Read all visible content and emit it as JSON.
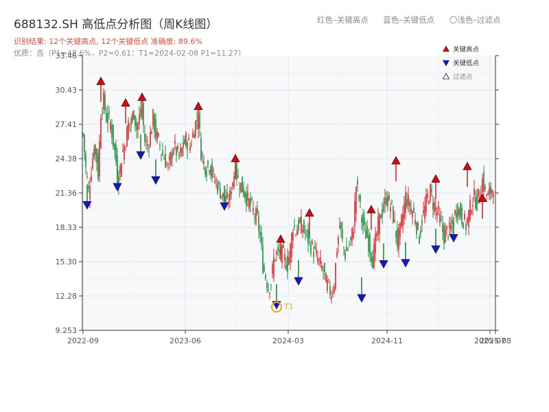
{
  "header": {
    "title": "688132.SH 高低点分析图（周K线图）",
    "result": "识别结果: 12个关键高点, 12个关键低点   准确度: 89.6%",
    "quality": "优质：否（P1=48.6%，P2=0.61；T1=2024-02-08 P1=11.27）"
  },
  "top_legend": {
    "high": "红色–关键高点",
    "low": "蓝色–关键低点",
    "filtered": "〇浅色–过滤点"
  },
  "colors": {
    "up": "#d62728",
    "down": "#1a8a3a",
    "high_marker": "#e8000b",
    "low_marker": "#1212d8",
    "t1_ring": "#f5a623",
    "plot_bg": "#f7f8fa",
    "grid": "#e3e6ea"
  },
  "chart_data": {
    "type": "candlestick",
    "x_axis": {
      "tick_labels": [
        "2022-09",
        "2023-06",
        "2024-03",
        "2024-11",
        "2025-07",
        "2025-08"
      ]
    },
    "y_axis": {
      "tick_labels": [
        "9.253",
        "12.28",
        "15.30",
        "18.33",
        "21.36",
        "24.38",
        "27.41",
        "30.43",
        "33.46"
      ],
      "ylim": [
        9.253,
        33.46
      ]
    },
    "grid": true,
    "legend": {
      "position": "top-right",
      "items": [
        {
          "name": "关键高点",
          "marker": "triangle-up"
        },
        {
          "name": "关键低点",
          "marker": "triangle-down"
        },
        {
          "name": "过滤点",
          "marker": "triangle-up-outline"
        }
      ]
    },
    "close_path": [
      [
        0,
        26.5
      ],
      [
        2,
        23.5
      ],
      [
        4,
        21.5
      ],
      [
        7,
        24.5
      ],
      [
        9,
        25.5
      ],
      [
        11,
        23.0
      ],
      [
        13,
        28.5
      ],
      [
        15,
        29.5
      ],
      [
        17,
        28.0
      ],
      [
        20,
        27.5
      ],
      [
        23,
        25.0
      ],
      [
        26,
        22.5
      ],
      [
        28,
        24.5
      ],
      [
        31,
        26.0
      ],
      [
        33,
        27.5
      ],
      [
        35,
        27.5
      ],
      [
        37,
        28.5
      ],
      [
        39,
        27.0
      ],
      [
        41,
        28.0
      ],
      [
        43,
        28.5
      ],
      [
        45,
        26.0
      ],
      [
        47,
        25.5
      ],
      [
        49,
        26.5
      ],
      [
        51,
        28.0
      ],
      [
        53,
        26.5
      ],
      [
        55,
        26.0
      ],
      [
        57,
        25.0
      ],
      [
        59,
        24.5
      ],
      [
        62,
        23.5
      ],
      [
        64,
        24.5
      ],
      [
        66,
        25.5
      ],
      [
        68,
        25.0
      ],
      [
        70,
        24.5
      ],
      [
        73,
        25.5
      ],
      [
        75,
        26.0
      ],
      [
        78,
        25.5
      ],
      [
        80,
        26.5
      ],
      [
        82,
        27.5
      ],
      [
        84,
        28.0
      ],
      [
        86,
        25.0
      ],
      [
        88,
        24.0
      ],
      [
        90,
        23.5
      ],
      [
        92,
        24.0
      ],
      [
        94,
        23.0
      ],
      [
        96,
        22.5
      ],
      [
        98,
        22.0
      ],
      [
        100,
        21.5
      ],
      [
        102,
        21.0
      ],
      [
        104,
        20.5
      ],
      [
        107,
        21.0
      ],
      [
        109,
        22.5
      ],
      [
        111,
        23.5
      ],
      [
        113,
        22.5
      ],
      [
        115,
        22.0
      ],
      [
        117,
        21.5
      ],
      [
        119,
        21.0
      ],
      [
        121,
        20.5
      ],
      [
        123,
        20.0
      ],
      [
        125,
        19.5
      ],
      [
        127,
        19.0
      ],
      [
        129,
        17.5
      ],
      [
        131,
        15.0
      ],
      [
        133,
        14.0
      ],
      [
        135,
        13.0
      ],
      [
        137,
        13.5
      ],
      [
        139,
        15.5
      ],
      [
        141,
        16.0
      ],
      [
        143,
        16.0
      ],
      [
        145,
        16.0
      ],
      [
        147,
        15.5
      ],
      [
        149,
        15.0
      ],
      [
        151,
        16.5
      ],
      [
        153,
        18.5
      ],
      [
        155,
        18.0
      ],
      [
        157,
        18.5
      ],
      [
        159,
        18.5
      ],
      [
        161,
        18.0
      ],
      [
        163,
        17.5
      ],
      [
        165,
        17.0
      ],
      [
        167,
        16.5
      ],
      [
        169,
        16.0
      ],
      [
        171,
        15.5
      ],
      [
        173,
        15.0
      ],
      [
        175,
        14.5
      ],
      [
        177,
        13.5
      ],
      [
        179,
        13.0
      ],
      [
        181,
        12.5
      ],
      [
        183,
        13.5
      ],
      [
        185,
        16.5
      ],
      [
        187,
        18.5
      ],
      [
        189,
        17.0
      ],
      [
        191,
        16.0
      ],
      [
        193,
        16.5
      ],
      [
        195,
        17.0
      ],
      [
        197,
        18.5
      ],
      [
        199,
        22.0
      ],
      [
        201,
        21.0
      ],
      [
        203,
        19.0
      ],
      [
        205,
        18.0
      ],
      [
        207,
        17.5
      ],
      [
        209,
        16.5
      ],
      [
        211,
        15.5
      ],
      [
        213,
        17.0
      ],
      [
        215,
        18.5
      ],
      [
        217,
        19.5
      ],
      [
        219,
        20.0
      ],
      [
        221,
        21.0
      ],
      [
        223,
        20.5
      ],
      [
        225,
        20.0
      ],
      [
        227,
        18.5
      ],
      [
        229,
        17.0
      ],
      [
        231,
        18.0
      ],
      [
        233,
        19.5
      ],
      [
        235,
        21.0
      ],
      [
        237,
        20.5
      ],
      [
        239,
        20.0
      ],
      [
        241,
        19.5
      ],
      [
        243,
        18.5
      ],
      [
        245,
        17.5
      ],
      [
        247,
        19.0
      ],
      [
        249,
        20.0
      ],
      [
        251,
        21.0
      ],
      [
        253,
        21.5
      ],
      [
        255,
        20.5
      ],
      [
        257,
        20.0
      ],
      [
        259,
        19.5
      ],
      [
        261,
        18.5
      ],
      [
        263,
        17.5
      ],
      [
        265,
        18.0
      ],
      [
        267,
        18.0
      ],
      [
        269,
        18.5
      ],
      [
        271,
        19.5
      ],
      [
        273,
        20.0
      ],
      [
        275,
        19.5
      ],
      [
        277,
        19.0
      ],
      [
        279,
        18.5
      ],
      [
        281,
        19.5
      ],
      [
        283,
        20.5
      ],
      [
        285,
        21.0
      ],
      [
        287,
        20.5
      ],
      [
        289,
        21.5
      ],
      [
        291,
        22.5
      ],
      [
        293,
        21.5
      ],
      [
        295,
        21.0
      ],
      [
        297,
        21.5
      ],
      [
        299,
        22.0
      ]
    ],
    "key_highs": [
      {
        "x": 13,
        "price": 31.2
      },
      {
        "x": 31,
        "price": 29.3
      },
      {
        "x": 43,
        "price": 29.8
      },
      {
        "x": 84,
        "price": 29.0
      },
      {
        "x": 111,
        "price": 24.4
      },
      {
        "x": 144,
        "price": 17.3
      },
      {
        "x": 165,
        "price": 19.6
      },
      {
        "x": 210,
        "price": 19.9
      },
      {
        "x": 228,
        "price": 24.2
      },
      {
        "x": 257,
        "price": 22.6
      },
      {
        "x": 280,
        "price": 23.7
      },
      {
        "x": 291,
        "price": 20.9
      }
    ],
    "key_lows": [
      {
        "x": 3,
        "price": 20.3
      },
      {
        "x": 25,
        "price": 21.9
      },
      {
        "x": 42,
        "price": 24.7
      },
      {
        "x": 53,
        "price": 22.5
      },
      {
        "x": 103,
        "price": 20.2
      },
      {
        "x": 141,
        "price": 11.5
      },
      {
        "x": 157,
        "price": 13.6
      },
      {
        "x": 203,
        "price": 12.1
      },
      {
        "x": 219,
        "price": 15.1
      },
      {
        "x": 235,
        "price": 15.2
      },
      {
        "x": 257,
        "price": 16.4
      },
      {
        "x": 270,
        "price": 17.4
      }
    ],
    "annotations": [
      {
        "label": "T1",
        "x": 141,
        "price": 11.3
      }
    ]
  }
}
